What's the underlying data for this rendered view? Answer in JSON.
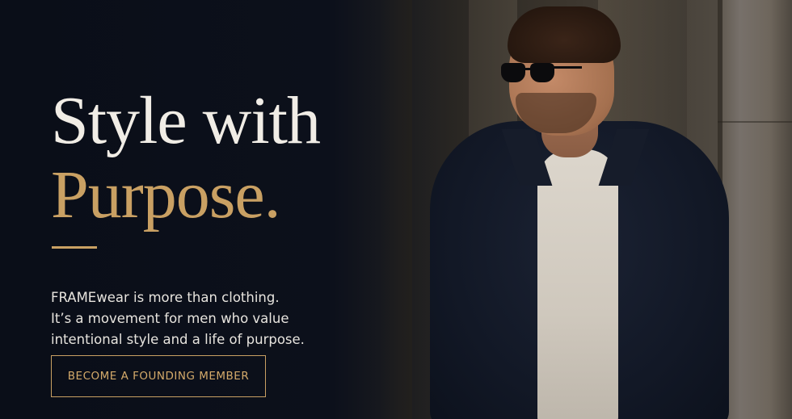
{
  "hero": {
    "headline_line1": "Style with",
    "headline_line2": "Purpose.",
    "description": [
      "FRAMEwear is more than clothing.",
      "It’s a movement for men who value",
      "intentional style and a life of purpose."
    ],
    "cta_label": "BECOME A FOUNDING MEMBER"
  },
  "colors": {
    "background": "#0b0f1a",
    "headline_primary": "#f1ede6",
    "accent_gold": "#c9a063",
    "body_text": "#e7e4de"
  },
  "image": {
    "subject": "model-photo"
  }
}
